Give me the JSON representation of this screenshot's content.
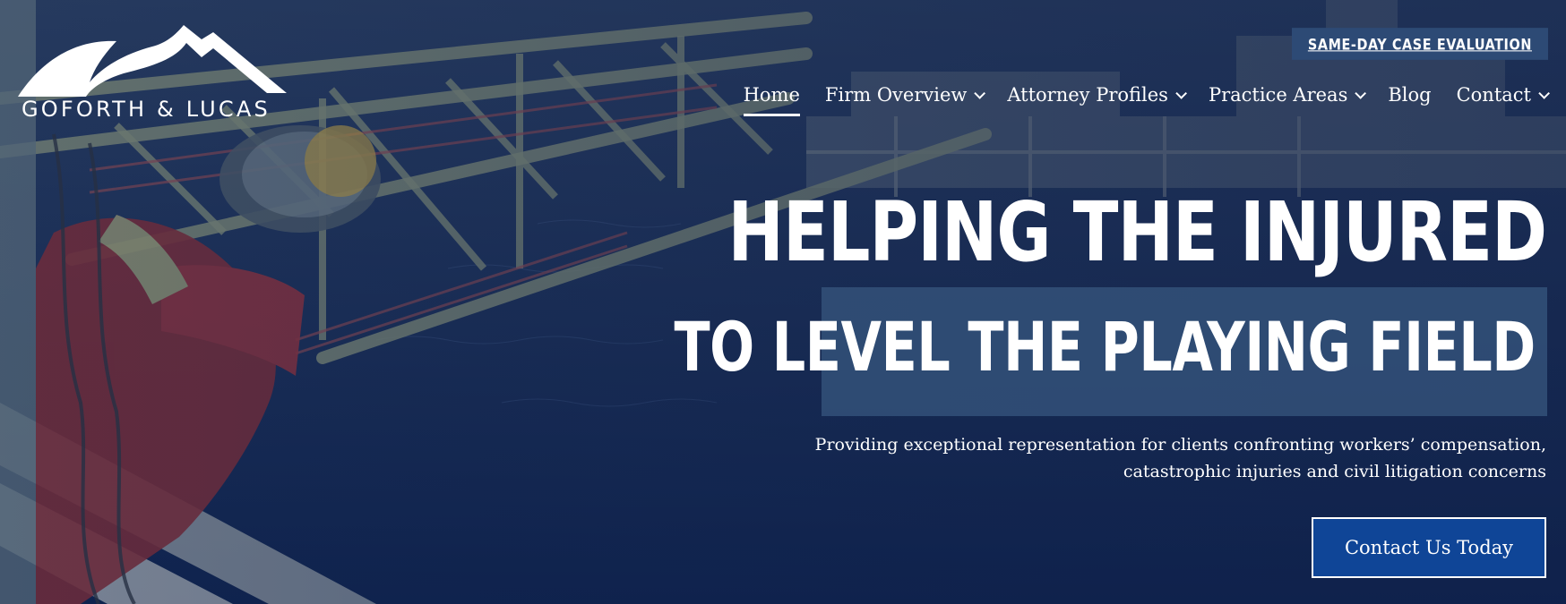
{
  "brand": {
    "logo_text": "GOFORTH & LUCAS"
  },
  "top_cta": {
    "label": "SAME-DAY CASE EVALUATION"
  },
  "nav": {
    "items": [
      {
        "label": "Home",
        "has_dropdown": false,
        "active": true
      },
      {
        "label": "Firm Overview",
        "has_dropdown": true,
        "active": false
      },
      {
        "label": "Attorney Profiles",
        "has_dropdown": true,
        "active": false
      },
      {
        "label": "Practice Areas",
        "has_dropdown": true,
        "active": false
      },
      {
        "label": "Blog",
        "has_dropdown": false,
        "active": false
      },
      {
        "label": "Contact",
        "has_dropdown": true,
        "active": false
      }
    ]
  },
  "hero": {
    "headline_line1": "HELPING THE INJURED",
    "headline_line2": "TO LEVEL THE PLAYING FIELD",
    "subtext_line1": "Providing exceptional representation for clients confronting workers’ compensation,",
    "subtext_line2": "catastrophic injuries and civil litigation concerns",
    "button_label": "Contact Us Today"
  },
  "colors": {
    "headline_box": "#325078",
    "button_bg": "#0f4597",
    "top_cta_bg": "#2d4a75"
  }
}
